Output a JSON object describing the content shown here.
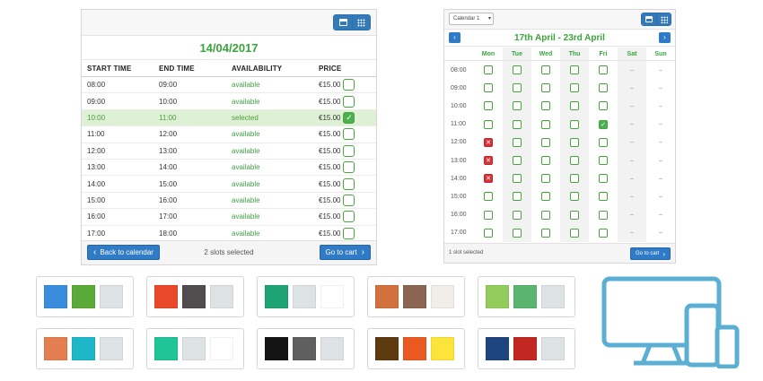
{
  "day_view": {
    "date": "14/04/2017",
    "headers": {
      "start": "START TIME",
      "end": "END TIME",
      "availability": "AVAILABILITY",
      "price": "PRICE"
    },
    "rows": [
      {
        "start": "08:00",
        "end": "09:00",
        "status": "available",
        "price": "€15.00",
        "checked": false
      },
      {
        "start": "09:00",
        "end": "10:00",
        "status": "available",
        "price": "€15.00",
        "checked": false
      },
      {
        "start": "10:00",
        "end": "11:00",
        "status": "selected",
        "price": "€15.00",
        "checked": true
      },
      {
        "start": "11:00",
        "end": "12:00",
        "status": "available",
        "price": "€15.00",
        "checked": false
      },
      {
        "start": "12:00",
        "end": "13:00",
        "status": "available",
        "price": "€15.00",
        "checked": false
      },
      {
        "start": "13:00",
        "end": "14:00",
        "status": "available",
        "price": "€15.00",
        "checked": false
      },
      {
        "start": "14:00",
        "end": "15:00",
        "status": "available",
        "price": "€15.00",
        "checked": false
      },
      {
        "start": "15:00",
        "end": "16:00",
        "status": "available",
        "price": "€15.00",
        "checked": false
      },
      {
        "start": "16:00",
        "end": "17:00",
        "status": "available",
        "price": "€15.00",
        "checked": false
      },
      {
        "start": "17:00",
        "end": "18:00",
        "status": "available",
        "price": "€15.00",
        "checked": false
      }
    ],
    "back_label": "Back to calendar",
    "slots_summary": "2 slots selected",
    "cart_label": "Go to cart"
  },
  "week_view": {
    "calendar_select": "Calendar 1",
    "title": "17th April - 23rd April",
    "days": [
      "Mon",
      "Tue",
      "Wed",
      "Thu",
      "Fri",
      "Sat",
      "Sun"
    ],
    "times": [
      "08:00",
      "09:00",
      "10:00",
      "11:00",
      "12:00",
      "13:00",
      "14:00",
      "15:00",
      "16:00",
      "17:00"
    ],
    "cells": [
      [
        "o",
        "o",
        "o",
        "o",
        "o",
        "-",
        "-"
      ],
      [
        "o",
        "o",
        "o",
        "o",
        "o",
        "-",
        "-"
      ],
      [
        "o",
        "o",
        "o",
        "o",
        "o",
        "-",
        "-"
      ],
      [
        "o",
        "o",
        "o",
        "o",
        "v",
        "-",
        "-"
      ],
      [
        "x",
        "o",
        "o",
        "o",
        "o",
        "-",
        "-"
      ],
      [
        "x",
        "o",
        "o",
        "o",
        "o",
        "-",
        "-"
      ],
      [
        "x",
        "o",
        "o",
        "o",
        "o",
        "-",
        "-"
      ],
      [
        "o",
        "o",
        "o",
        "o",
        "o",
        "-",
        "-"
      ],
      [
        "o",
        "o",
        "o",
        "o",
        "o",
        "-",
        "-"
      ],
      [
        "o",
        "o",
        "o",
        "o",
        "o",
        "-",
        "-"
      ]
    ],
    "dash_text": "–",
    "slots_summary": "1 slot selected",
    "cart_label": "Go to cart"
  },
  "icons": {
    "calendar_view": "calendar-icon",
    "grid_view": "grid-icon",
    "check": "✓",
    "cross": "✕",
    "prev": "‹",
    "next": "›",
    "select_caret": "▾",
    "devices": "responsive-devices-icon"
  },
  "color_themes": [
    [
      "#3a8ddc",
      "#5aaa3a",
      "#dde2e5"
    ],
    [
      "#e9492a",
      "#514c4d",
      "#dde2e5"
    ],
    [
      "#1ea374",
      "#dde2e5",
      "#ffffff"
    ],
    [
      "#d2713d",
      "#8b6552",
      "#f1eeea"
    ],
    [
      "#94cc5c",
      "#5bb56e",
      "#dde2e5"
    ],
    [
      "#e47d4f",
      "#1db7c7",
      "#dde2e5"
    ],
    [
      "#1fc497",
      "#dde2e5",
      "#ffffff"
    ],
    [
      "#141414",
      "#5f5f5f",
      "#dde2e5"
    ],
    [
      "#5d3a10",
      "#e95920",
      "#fde43a"
    ],
    [
      "#1f4581",
      "#c22722",
      "#dde2e5"
    ]
  ],
  "colors": {
    "accent_green": "#3aa53a",
    "primary_blue": "#2f7bc6",
    "devices_blue": "#5aafd3"
  }
}
